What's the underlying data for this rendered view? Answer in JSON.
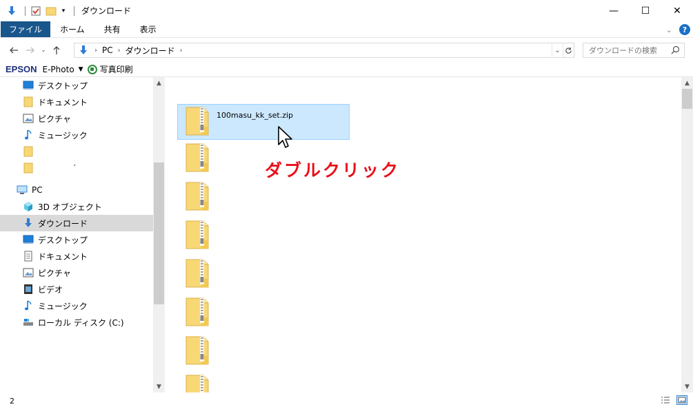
{
  "window": {
    "title": "ダウンロード",
    "controls": {
      "minimize": "—",
      "maximize": "☐",
      "close": "✕"
    }
  },
  "ribbon": {
    "tabs": [
      {
        "label": "ファイル",
        "active": true
      },
      {
        "label": "ホーム"
      },
      {
        "label": "共有"
      },
      {
        "label": "表示"
      }
    ],
    "expand": "⌄",
    "help": "?"
  },
  "address": {
    "breadcrumbs": [
      "PC",
      "ダウンロード"
    ],
    "search_placeholder": "ダウンロードの検索"
  },
  "epson_toolbar": {
    "brand": "EPSON",
    "app": "E-Photo",
    "print_label": "写真印刷"
  },
  "nav_pane": {
    "items": [
      {
        "label": "デスクトップ",
        "icon": "desktop-icon"
      },
      {
        "label": "ドキュメント",
        "icon": "folder-icon"
      },
      {
        "label": "ピクチャ",
        "icon": "pictures-icon"
      },
      {
        "label": "ミュージック",
        "icon": "music-icon"
      },
      {
        "label": "",
        "icon": "folder-icon"
      },
      {
        "label": "′",
        "icon": "folder-icon"
      },
      {
        "label": "PC",
        "icon": "pc-icon"
      },
      {
        "label": "3D オブジェクト",
        "icon": "3d-objects-icon"
      },
      {
        "label": "ダウンロード",
        "icon": "download-icon",
        "selected": true
      },
      {
        "label": "デスクトップ",
        "icon": "desktop-icon"
      },
      {
        "label": "ドキュメント",
        "icon": "document-icon"
      },
      {
        "label": "ピクチャ",
        "icon": "pictures-icon"
      },
      {
        "label": "ビデオ",
        "icon": "video-icon"
      },
      {
        "label": "ミュージック",
        "icon": "music-icon"
      },
      {
        "label": "ローカル ディスク (C:)",
        "icon": "drive-icon"
      }
    ]
  },
  "content": {
    "selected_file": "100masu_kk_set.zip",
    "overlay_text": "ダブルクリック",
    "zip_icon_count": 8
  },
  "status": {
    "item_count": "2"
  },
  "colors": {
    "file_tab": "#19568b",
    "selection": "#cce8ff",
    "overlay": "#e8101a",
    "folder_yellow": "#f8d775"
  }
}
